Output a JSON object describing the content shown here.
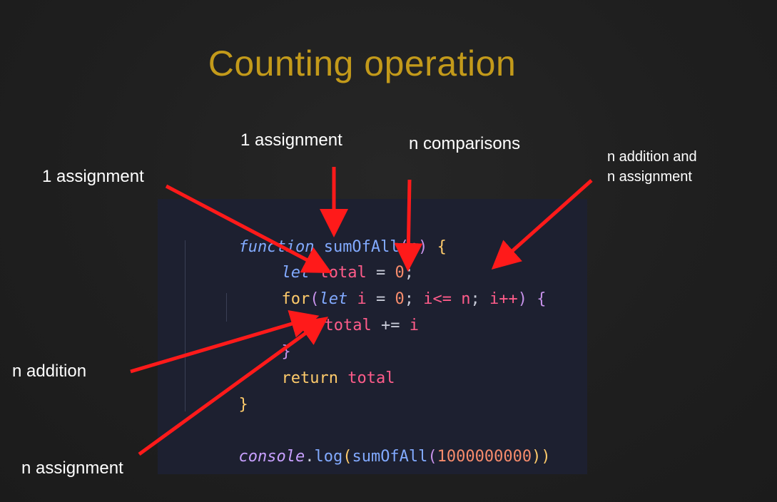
{
  "slide": {
    "title": "Counting operation"
  },
  "annotations": {
    "assignment_top": "1 assignment",
    "assignment_left": "1 assignment",
    "comparisons": "n comparisons",
    "addition_assignment": "n addition and\nn assignment",
    "addition": "n addition",
    "assignment_bottom": "n assignment"
  },
  "code": {
    "l1_function": "function",
    "l1_name": " sumOfAll",
    "l1_paren_open": "(",
    "l1_param": "n",
    "l1_paren_close": ")",
    "l1_brace": " {",
    "l2_let": "let",
    "l2_rest": " total",
    "l2_eq": " = ",
    "l2_num": "0",
    "l2_semi": ";",
    "l3_for": "for",
    "l3_paren": "(",
    "l3_let": "let",
    "l3_i": " i",
    "l3_eq": " = ",
    "l3_zero": "0",
    "l3_semi1": "; ",
    "l3_cond": "i<= n",
    "l3_semi2": "; ",
    "l3_inc": "i++",
    "l3_close": ")",
    "l3_brace": " {",
    "l4_total": "total",
    "l4_op": " += ",
    "l4_i": "i",
    "l5_brace": "}",
    "l6_return": "return",
    "l6_total": " total",
    "l7_brace": "}",
    "l8_console": "console",
    "l8_dot": ".",
    "l8_log": "log",
    "l8_open": "(",
    "l8_fn": "sumOfAll",
    "l8_open2": "(",
    "l8_num": "1000000000",
    "l8_close": "))"
  },
  "colors": {
    "title": "#c39a1a",
    "arrow": "#ff1a1a",
    "background": "#1f1f1f",
    "code_background": "#1d2030"
  }
}
